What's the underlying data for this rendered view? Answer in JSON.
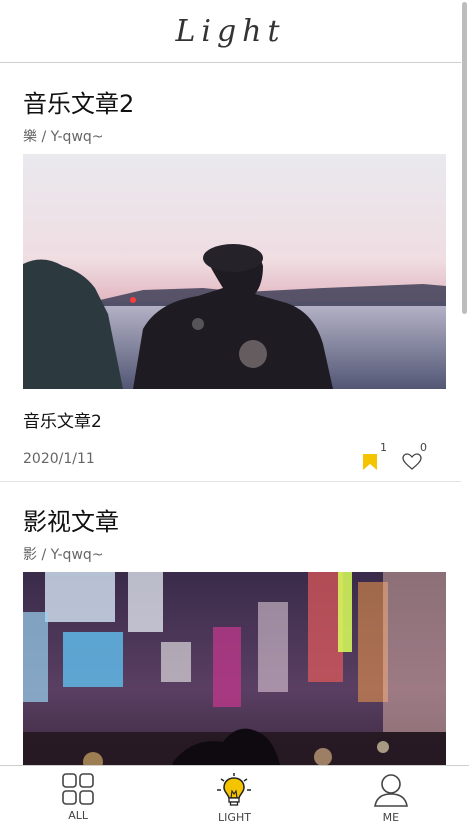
{
  "header": {
    "title": "Light"
  },
  "posts": [
    {
      "title": "音乐文章2",
      "meta": "樂 / Y-qwq~",
      "caption": "音乐文章2",
      "date": "2020/1/11",
      "bookmarks": "1",
      "likes": "0"
    },
    {
      "title": "影视文章",
      "meta": "影 / Y-qwq~"
    }
  ],
  "tabbar": {
    "items": [
      {
        "label": "ALL",
        "icon": "grid-icon"
      },
      {
        "label": "LIGHT",
        "icon": "lightbulb-icon"
      },
      {
        "label": "ME",
        "icon": "user-icon"
      }
    ]
  },
  "colors": {
    "accent": "#f5c400",
    "divider": "#cfcfcf"
  }
}
